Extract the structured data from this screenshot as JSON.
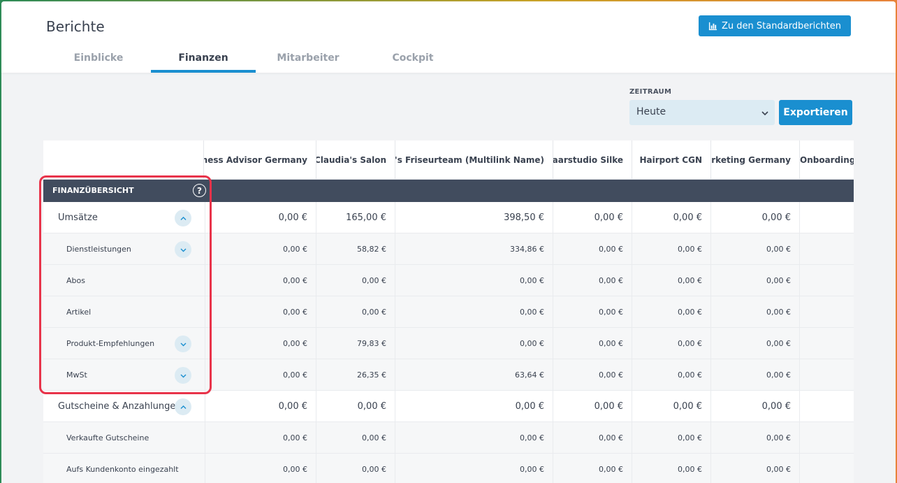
{
  "header": {
    "title": "Berichte",
    "standard_button": "Zu den Standardberichten",
    "tabs": [
      {
        "label": "Einblicke"
      },
      {
        "label": "Finanzen"
      },
      {
        "label": "Mitarbeiter"
      },
      {
        "label": "Cockpit"
      }
    ],
    "active_tab": "Finanzen"
  },
  "filters": {
    "zeitraum_label": "ZEITRAUM",
    "zeitraum_value": "Heute",
    "export_label": "Exportieren"
  },
  "table": {
    "columns": [
      "Business Advisor Germany",
      "Claudia's Salon",
      "Daniel's Friseurteam (Multilink Name)",
      "Haarstudio Silke",
      "Hairport CGN",
      "Marketing Germany",
      "Onboarding Ge"
    ],
    "section_title": "FINANZÜBERSICHT",
    "help_icon": "question-circle-icon",
    "rows": [
      {
        "label": "Umsätze",
        "type": "main",
        "toggle": "up",
        "values": [
          "0,00 €",
          "165,00 €",
          "398,50 €",
          "0,00 €",
          "0,00 €",
          "0,00 €",
          ""
        ]
      },
      {
        "label": "Dienstleistungen",
        "type": "sub",
        "toggle": "down",
        "values": [
          "0,00 €",
          "58,82 €",
          "334,86 €",
          "0,00 €",
          "0,00 €",
          "0,00 €",
          ""
        ]
      },
      {
        "label": "Abos",
        "type": "sub",
        "toggle": "",
        "values": [
          "0,00 €",
          "0,00 €",
          "0,00 €",
          "0,00 €",
          "0,00 €",
          "0,00 €",
          ""
        ]
      },
      {
        "label": "Artikel",
        "type": "sub",
        "toggle": "",
        "values": [
          "0,00 €",
          "0,00 €",
          "0,00 €",
          "0,00 €",
          "0,00 €",
          "0,00 €",
          ""
        ]
      },
      {
        "label": "Produkt-Empfehlungen",
        "type": "sub",
        "toggle": "down",
        "values": [
          "0,00 €",
          "79,83 €",
          "0,00 €",
          "0,00 €",
          "0,00 €",
          "0,00 €",
          ""
        ]
      },
      {
        "label": "MwSt",
        "type": "sub",
        "toggle": "down",
        "values": [
          "0,00 €",
          "26,35 €",
          "63,64 €",
          "0,00 €",
          "0,00 €",
          "0,00 €",
          ""
        ]
      },
      {
        "label": "Gutscheine & Anzahlungen",
        "type": "main",
        "toggle": "up",
        "values": [
          "0,00 €",
          "0,00 €",
          "0,00 €",
          "0,00 €",
          "0,00 €",
          "0,00 €",
          ""
        ]
      },
      {
        "label": "Verkaufte Gutscheine",
        "type": "sub",
        "toggle": "",
        "values": [
          "0,00 €",
          "0,00 €",
          "0,00 €",
          "0,00 €",
          "0,00 €",
          "0,00 €",
          ""
        ]
      },
      {
        "label": "Aufs Kundenkonto eingezahlt",
        "type": "sub",
        "toggle": "",
        "values": [
          "0,00 €",
          "0,00 €",
          "0,00 €",
          "0,00 €",
          "0,00 €",
          "0,00 €",
          ""
        ]
      }
    ]
  },
  "colors": {
    "accent": "#1a8fd0",
    "section_bar": "#414c5e",
    "highlight": "#e8334a"
  }
}
